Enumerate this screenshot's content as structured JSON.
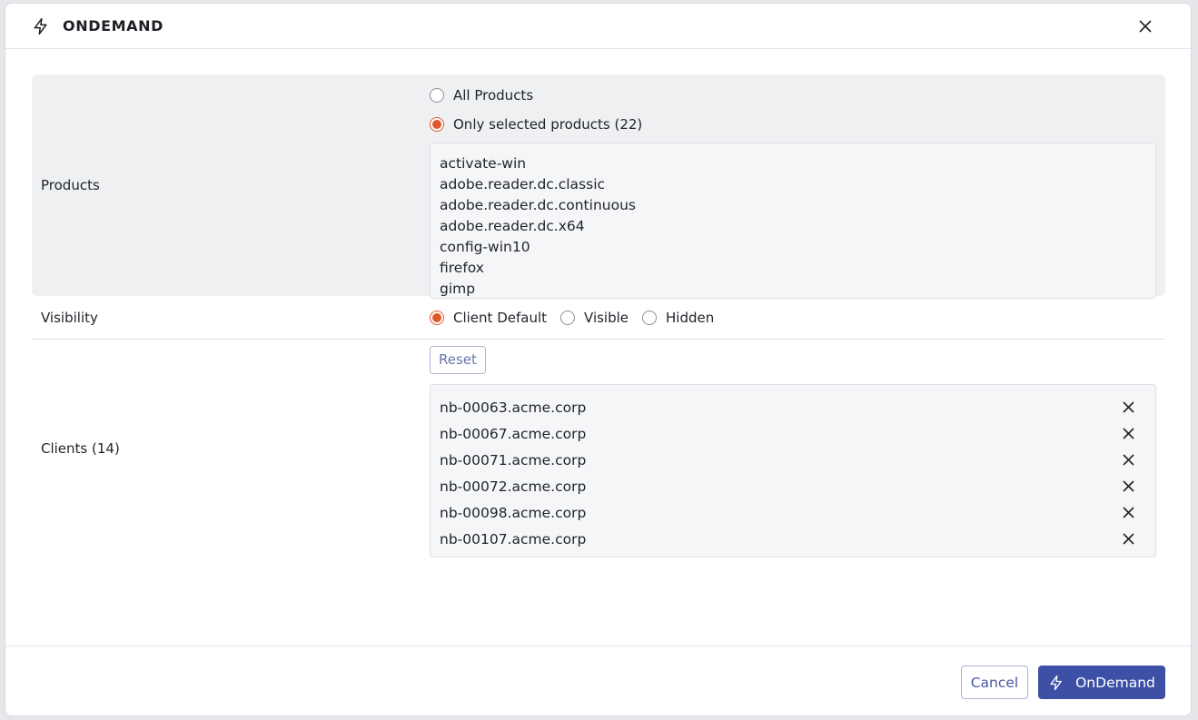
{
  "modal": {
    "title": "ONDEMAND",
    "title_icon": "lightning-bolt-icon",
    "close_icon": "close-icon"
  },
  "products": {
    "label": "Products",
    "options": [
      {
        "label": "All Products",
        "checked": false
      },
      {
        "label": "Only selected products (22)",
        "checked": true
      }
    ],
    "items": [
      "activate-win",
      "adobe.reader.dc.classic",
      "adobe.reader.dc.continuous",
      "adobe.reader.dc.x64",
      "config-win10",
      "firefox",
      "gimp"
    ]
  },
  "visibility": {
    "label": "Visibility",
    "options": [
      {
        "label": "Client Default",
        "checked": true
      },
      {
        "label": "Visible",
        "checked": false
      },
      {
        "label": "Hidden",
        "checked": false
      }
    ]
  },
  "clients": {
    "label": "Clients (14)",
    "reset_label": "Reset",
    "items": [
      "nb-00063.acme.corp",
      "nb-00067.acme.corp",
      "nb-00071.acme.corp",
      "nb-00072.acme.corp",
      "nb-00098.acme.corp",
      "nb-00107.acme.corp"
    ]
  },
  "footer": {
    "cancel_label": "Cancel",
    "ondemand_label": "OnDemand",
    "ondemand_icon": "lightning-bolt-icon"
  },
  "colors": {
    "accent": "#e0592a",
    "primary": "#3d50a6"
  }
}
